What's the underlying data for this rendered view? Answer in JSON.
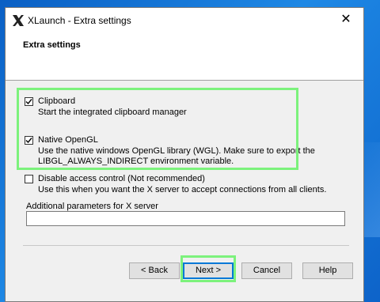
{
  "window": {
    "title": "XLaunch - Extra settings",
    "close_label": "✕"
  },
  "header": {
    "title": "Extra settings"
  },
  "options": [
    {
      "label": "Clipboard",
      "checked": true,
      "description": [
        "Start the integrated clipboard manager"
      ]
    },
    {
      "label": "Native OpenGL",
      "checked": true,
      "description": [
        "Use the native windows OpenGL library (WGL). Make sure to export the",
        "LIBGL_ALWAYS_INDIRECT environment variable."
      ]
    },
    {
      "label": "Disable access control (Not recommended)",
      "checked": false,
      "description": [
        "Use this when you want the X server to accept connections from all clients."
      ]
    }
  ],
  "params": {
    "label": "Additional parameters for X server",
    "value": ""
  },
  "buttons": {
    "back": "< Back",
    "next": "Next >",
    "cancel": "Cancel",
    "help": "Help"
  },
  "colors": {
    "highlight": "#7cf27c",
    "desktop": "#1e88e5",
    "primary_border": "#0078d7"
  }
}
